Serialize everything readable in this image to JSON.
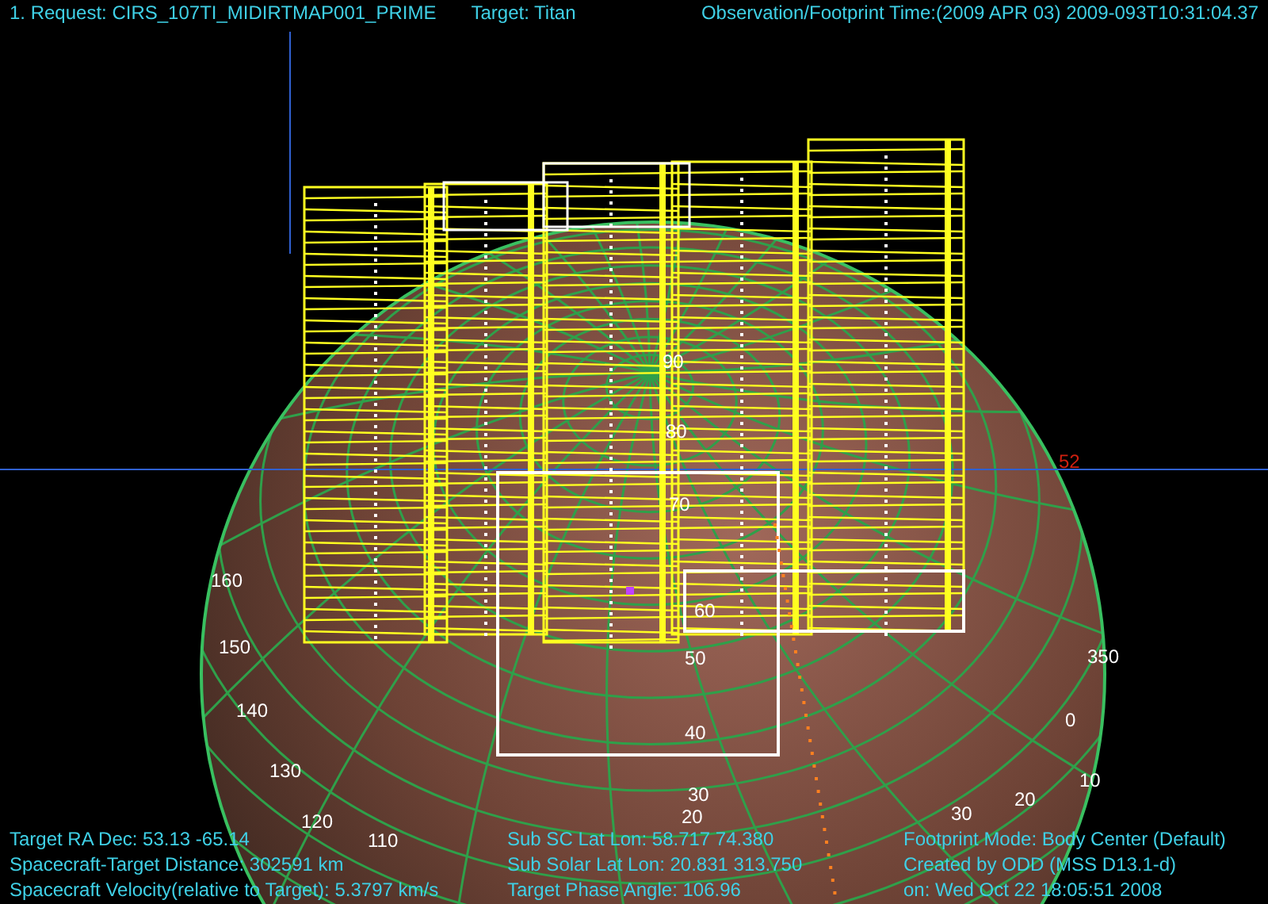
{
  "header": {
    "request": "1. Request: CIRS_107TI_MIDIRTMAP001_PRIME",
    "target": "Target: Titan",
    "time": "Observation/Footprint Time:(2009 APR 03) 2009-093T10:31:04.37"
  },
  "globe": {
    "latitude_labels": [
      "90",
      "80",
      "70",
      "60",
      "50",
      "40",
      "30",
      "20"
    ],
    "longitude_labels": [
      "160",
      "150",
      "140",
      "130",
      "120",
      "110",
      "350",
      "0",
      "10",
      "20",
      "30"
    ],
    "marker_label": "52"
  },
  "info_left": [
    "Target RA Dec: 53.13  -65.14",
    "Spacecraft-Target Distance:  302591 km",
    "Spacecraft Velocity(relative to Target): 5.3797 km/s"
  ],
  "info_middle": [
    "Sub SC Lat Lon: 58.717  74.380",
    "Sub Solar Lat Lon: 20.831  313.750",
    "Target Phase Angle: 106.96"
  ],
  "info_right": [
    "Footprint Mode: Body Center (Default)",
    "Created by ODD (MSS D13.1-d)",
    "on: Wed Oct 22 18:05:51 2008"
  ]
}
